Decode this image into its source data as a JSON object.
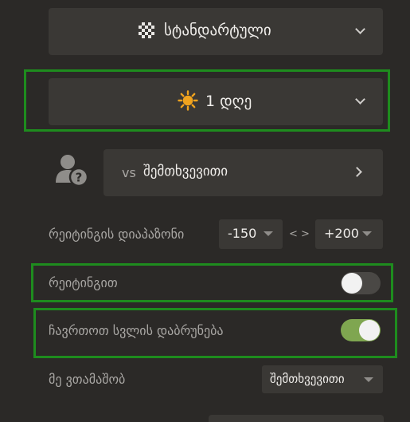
{
  "variant": {
    "label": "სტანდარტული",
    "icon": "chessboard-icon"
  },
  "time_control": {
    "label": "1 დღე",
    "icon": "sun-icon",
    "icon_color": "#f0a31e"
  },
  "opponent": {
    "prefix": "vs",
    "label": "შემთხვევითი",
    "icon": "person-question-icon"
  },
  "rating_range": {
    "label": "რეიტინგის დიაპაზონი",
    "min": "-150",
    "separator": "< >",
    "max": "+200"
  },
  "rated": {
    "label": "რეიტინგით",
    "enabled": false
  },
  "takebacks": {
    "label": "ჩავრთოთ სვლის დაბრუნება",
    "enabled": true
  },
  "play_as": {
    "label": "მე ვთამაშობ",
    "value": "შემთხვევითი"
  },
  "colors": {
    "background": "#2b2927",
    "panel": "#3a3835",
    "highlight": "#1e8c1e",
    "toggle_on": "#7fa650",
    "toggle_off": "#4a4845"
  }
}
